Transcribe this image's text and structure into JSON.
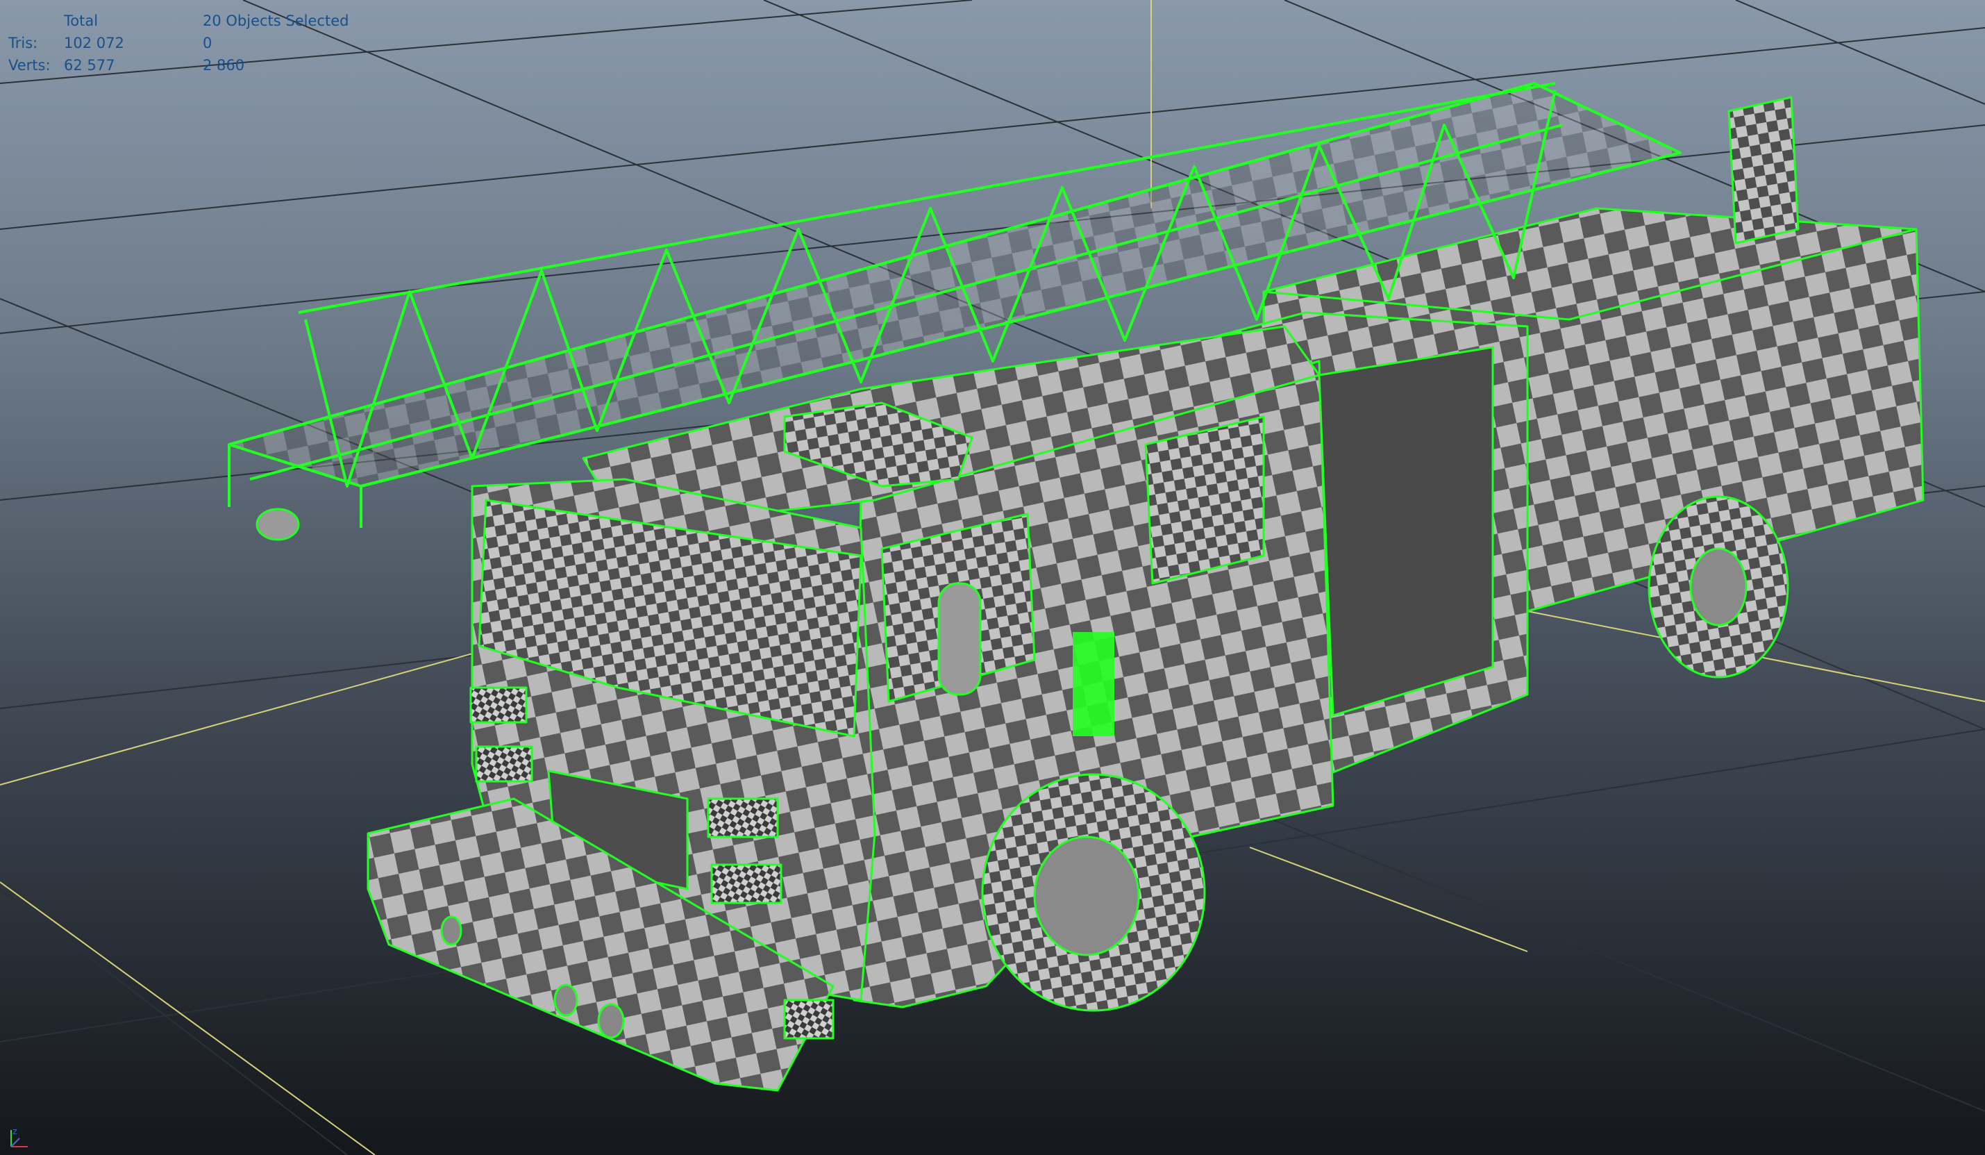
{
  "hud": {
    "total_header": "Total",
    "selected_header": "20 Objects Selected",
    "rows": [
      {
        "label": "Tris:",
        "total": "102 072",
        "selected": "0"
      },
      {
        "label": "Verts:",
        "total": "62 577",
        "selected": "2 860"
      }
    ]
  },
  "scene": {
    "object": "fire truck model",
    "background_top": "#8a99aa",
    "background_bottom": "#14171b",
    "grid_color": "#2b3138",
    "axis_line_color": "#d6d27a",
    "selection_color": "#22ff22",
    "checker_light": "#b9b9b9",
    "checker_dark": "#5a5a5a"
  },
  "axis_indicator": {
    "x_color": "#d63a3a",
    "y_color": "#3ad63a",
    "z_color": "#3a6bd6",
    "z_label": "Z"
  }
}
